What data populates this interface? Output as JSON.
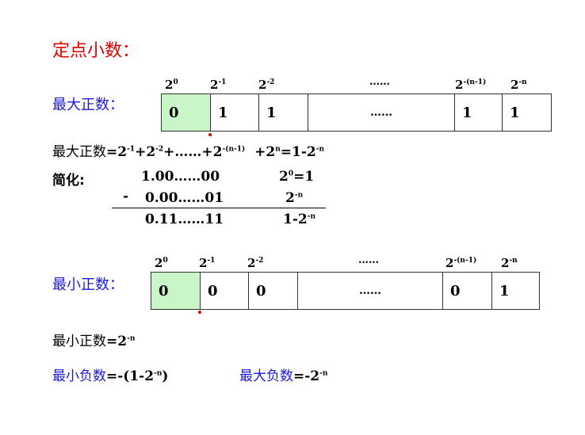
{
  "title": "定点小数：",
  "max_positive": {
    "label": "最大正数：",
    "exponents": [
      "2",
      "0",
      "2",
      "-1",
      "2",
      "-2",
      "……",
      "2",
      "-(n-1)",
      "2",
      "-n"
    ],
    "cells": [
      "0",
      "1",
      "1",
      "……",
      "1",
      "1"
    ]
  },
  "max_formula": {
    "prefix": "最大正数",
    "parts": [
      "=2",
      "-1",
      "+2",
      "-2",
      "+……+2",
      "-(n-1)",
      "+2",
      "n",
      "=1-2",
      "-n"
    ]
  },
  "simplify": {
    "label": "简化:",
    "row1": "1.00……00",
    "row1_right": [
      "2",
      "0",
      "=1"
    ],
    "minus": "-",
    "row2": "0.00……01",
    "row2_right": [
      "2",
      "-n"
    ],
    "row3": "0.11……11",
    "row3_right": [
      "1-2",
      "-n"
    ]
  },
  "min_positive": {
    "label": "最小正数：",
    "exponents": [
      "2",
      "0",
      "2",
      "-1",
      "2",
      "-2",
      "……",
      "2",
      "-(n-1)",
      "2",
      "-n"
    ],
    "cells": [
      "0",
      "0",
      "0",
      "……",
      "0",
      "1"
    ]
  },
  "min_formula": {
    "prefix": "最小正数",
    "parts": [
      "=2",
      "-n"
    ]
  },
  "min_negative": {
    "prefix": "最小负数",
    "parts": [
      "=-(1-2",
      "-n",
      ")"
    ]
  },
  "max_negative": {
    "prefix": "最大负数",
    "parts": [
      "=-2",
      "-n"
    ]
  },
  "colors": {
    "title": "#e00000",
    "label": "#1a1ad6",
    "cell_highlight": "#c9f5c9"
  }
}
